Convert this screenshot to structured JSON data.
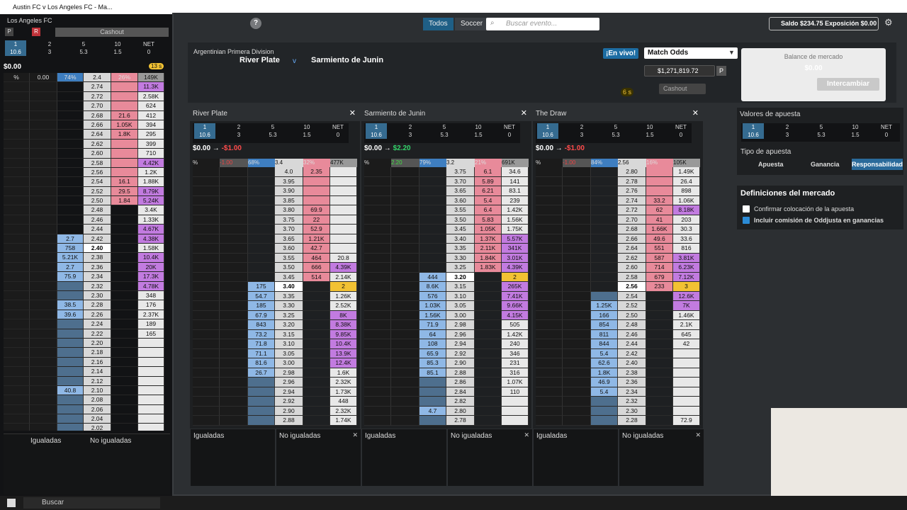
{
  "window": {
    "left_title": "Austin FC v Los Angeles FC - Ma..."
  },
  "topbar": {
    "help": "?",
    "tabs": [
      "Todos",
      "Soccer"
    ],
    "search_placeholder": "Buscar evento...",
    "saldo": "Saldo $234.75",
    "exposicion": "Exposición $0.00"
  },
  "event": {
    "league": "Argentinian Primera Division",
    "home": "River Plate",
    "vs": "v",
    "away": "Sarmiento de Junin",
    "live": "¡En vivo!",
    "market": "Match Odds",
    "matched": "$1,271,819.72",
    "timer": "6 s",
    "cashout": "Cashout",
    "p": "P",
    "q": "?"
  },
  "balance": {
    "label": "Balance de mercado",
    "value": "$0.00",
    "swap": "Intercambiar"
  },
  "stakes": [
    {
      "top": "1",
      "bot": "10.6"
    },
    {
      "top": "2",
      "bot": "3"
    },
    {
      "top": "5",
      "bot": "5.3"
    },
    {
      "top": "10",
      "bot": "1.5"
    },
    {
      "top": "NET",
      "bot": "0"
    }
  ],
  "panels": [
    {
      "name": "River Plate",
      "pnl_a": "$0.00",
      "pnl_b": "-$1.00",
      "hdr": [
        "%",
        "-1.00",
        "68%",
        "3.4",
        "32%",
        "477K"
      ],
      "rows": [
        [
          "",
          "",
          "",
          "4.0",
          "2.35",
          ""
        ],
        [
          "",
          "",
          "",
          "3.95",
          "",
          ""
        ],
        [
          "",
          "",
          "",
          "3.90",
          "",
          ""
        ],
        [
          "",
          "",
          "",
          "3.85",
          "",
          ""
        ],
        [
          "",
          "",
          "",
          "3.80",
          "69.9",
          ""
        ],
        [
          "",
          "",
          "",
          "3.75",
          "22",
          ""
        ],
        [
          "",
          "",
          "",
          "3.70",
          "52.9",
          ""
        ],
        [
          "",
          "",
          "",
          "3.65",
          "1.21K",
          ""
        ],
        [
          "",
          "",
          "",
          "3.60",
          "42.7",
          ""
        ],
        [
          "",
          "",
          "",
          "3.55",
          "464",
          "20.8"
        ],
        [
          "",
          "",
          "",
          "3.50",
          "666",
          "4.39K"
        ],
        [
          "",
          "",
          "",
          "3.45",
          "514",
          "2.14K"
        ],
        [
          "",
          "",
          "175",
          "3.40",
          "",
          "2"
        ],
        [
          "",
          "",
          "54.7",
          "3.35",
          "",
          "1.26K"
        ],
        [
          "",
          "",
          "185",
          "3.30",
          "",
          "2.52K"
        ],
        [
          "",
          "",
          "67.9",
          "3.25",
          "",
          "8K"
        ],
        [
          "",
          "",
          "843",
          "3.20",
          "",
          "8.38K"
        ],
        [
          "",
          "",
          "73.2",
          "3.15",
          "",
          "9.85K"
        ],
        [
          "",
          "",
          "71.8",
          "3.10",
          "",
          "10.4K"
        ],
        [
          "",
          "",
          "71.1",
          "3.05",
          "",
          "13.9K"
        ],
        [
          "",
          "",
          "81.6",
          "3.00",
          "",
          "12.4K"
        ],
        [
          "",
          "",
          "26.7",
          "2.98",
          "",
          "1.6K"
        ],
        [
          "",
          "",
          "",
          "2.96",
          "",
          "2.32K"
        ],
        [
          "",
          "",
          "",
          "2.94",
          "",
          "1.73K"
        ],
        [
          "",
          "",
          "",
          "2.92",
          "",
          "448"
        ],
        [
          "",
          "",
          "",
          "2.90",
          "",
          "2.32K"
        ],
        [
          "",
          "",
          "",
          "2.88",
          "",
          "1.74K"
        ]
      ],
      "cur": 12
    },
    {
      "name": "Sarmiento de Junin",
      "pnl_a": "$0.00",
      "pnl_b": "$2.20",
      "hdr": [
        "%",
        "2.20",
        "79%",
        "3.2",
        "21%",
        "691K"
      ],
      "rows": [
        [
          "",
          "",
          "",
          "3.75",
          "6.1",
          "34.6"
        ],
        [
          "",
          "",
          "",
          "3.70",
          "5.89",
          "141"
        ],
        [
          "",
          "",
          "",
          "3.65",
          "6.21",
          "83.1"
        ],
        [
          "",
          "",
          "",
          "3.60",
          "5.4",
          "239"
        ],
        [
          "",
          "",
          "",
          "3.55",
          "6.4",
          "1.42K"
        ],
        [
          "",
          "",
          "",
          "3.50",
          "5.83",
          "1.56K"
        ],
        [
          "",
          "",
          "",
          "3.45",
          "1.05K",
          "1.75K"
        ],
        [
          "",
          "",
          "",
          "3.40",
          "1.37K",
          "5.57K"
        ],
        [
          "",
          "",
          "",
          "3.35",
          "2.11K",
          "341K"
        ],
        [
          "",
          "",
          "",
          "3.30",
          "1.84K",
          "3.01K"
        ],
        [
          "",
          "",
          "",
          "3.25",
          "1.83K",
          "4.39K"
        ],
        [
          "",
          "",
          "444",
          "3.20",
          "",
          "2"
        ],
        [
          "",
          "",
          "8.6K",
          "3.15",
          "",
          "265K"
        ],
        [
          "",
          "",
          "576",
          "3.10",
          "",
          "7.41K"
        ],
        [
          "",
          "",
          "1.03K",
          "3.05",
          "",
          "9.66K"
        ],
        [
          "",
          "",
          "1.56K",
          "3.00",
          "",
          "4.15K"
        ],
        [
          "",
          "",
          "71.9",
          "2.98",
          "",
          "505"
        ],
        [
          "",
          "",
          "64",
          "2.96",
          "",
          "1.42K"
        ],
        [
          "",
          "",
          "108",
          "2.94",
          "",
          "240"
        ],
        [
          "",
          "",
          "65.9",
          "2.92",
          "",
          "346"
        ],
        [
          "",
          "",
          "85.3",
          "2.90",
          "",
          "231"
        ],
        [
          "",
          "",
          "85.1",
          "2.88",
          "",
          "316"
        ],
        [
          "",
          "",
          "",
          "2.86",
          "",
          "1.07K"
        ],
        [
          "",
          "",
          "",
          "2.84",
          "",
          "110"
        ],
        [
          "",
          "",
          "",
          "2.82",
          "",
          ""
        ],
        [
          "",
          "",
          "4.7",
          "2.80",
          "",
          ""
        ],
        [
          "",
          "",
          "",
          "2.78",
          "",
          ""
        ]
      ],
      "cur": 11
    },
    {
      "name": "The Draw",
      "pnl_a": "$0.00",
      "pnl_b": "-$1.00",
      "hdr": [
        "%",
        "-1.00",
        "84%",
        "2.56",
        "16%",
        "105K"
      ],
      "rows": [
        [
          "",
          "",
          "",
          "2.80",
          "",
          "1.49K"
        ],
        [
          "",
          "",
          "",
          "2.78",
          "",
          "26.4"
        ],
        [
          "",
          "",
          "",
          "2.76",
          "",
          "898"
        ],
        [
          "",
          "",
          "",
          "2.74",
          "33.2",
          "1.06K"
        ],
        [
          "",
          "",
          "",
          "2.72",
          "62",
          "8.18K"
        ],
        [
          "",
          "",
          "",
          "2.70",
          "41",
          "203"
        ],
        [
          "",
          "",
          "",
          "2.68",
          "1.66K",
          "30.3"
        ],
        [
          "",
          "",
          "",
          "2.66",
          "49.6",
          "33.6"
        ],
        [
          "",
          "",
          "",
          "2.64",
          "551",
          "816"
        ],
        [
          "",
          "",
          "",
          "2.62",
          "587",
          "3.81K"
        ],
        [
          "",
          "",
          "",
          "2.60",
          "714",
          "6.23K"
        ],
        [
          "",
          "",
          "",
          "2.58",
          "679",
          "7.12K"
        ],
        [
          "",
          "",
          "",
          "2.56",
          "233",
          "3"
        ],
        [
          "",
          "",
          "",
          "2.54",
          "",
          "12.6K"
        ],
        [
          "",
          "",
          "1.25K",
          "2.52",
          "",
          "7K"
        ],
        [
          "",
          "",
          "166",
          "2.50",
          "",
          "1.46K"
        ],
        [
          "",
          "",
          "854",
          "2.48",
          "",
          "2.1K"
        ],
        [
          "",
          "",
          "811",
          "2.46",
          "",
          "645"
        ],
        [
          "",
          "",
          "844",
          "2.44",
          "",
          "42"
        ],
        [
          "",
          "",
          "5.4",
          "2.42",
          "",
          ""
        ],
        [
          "",
          "",
          "62.6",
          "2.40",
          "",
          ""
        ],
        [
          "",
          "",
          "1.8K",
          "2.38",
          "",
          ""
        ],
        [
          "",
          "",
          "46.9",
          "2.36",
          "",
          ""
        ],
        [
          "",
          "",
          "5.4",
          "2.34",
          "",
          ""
        ],
        [
          "",
          "",
          "",
          "2.32",
          "",
          ""
        ],
        [
          "",
          "",
          "",
          "2.30",
          "",
          ""
        ],
        [
          "",
          "",
          "",
          "2.28",
          "",
          "72.9"
        ]
      ],
      "cur": 12
    }
  ],
  "bets": {
    "matched": "Igualadas",
    "unmatched": "No igualadas"
  },
  "valores": {
    "title": "Valores de apuesta",
    "tipo": "Tipo de apuesta",
    "types": [
      "Apuesta",
      "Ganancia",
      "Responsabilidad"
    ]
  },
  "defs": {
    "title": "Definiciones del mercado",
    "opt1": "Confirmar colocación de la apuesta",
    "opt2": "Incluir comisión de Oddjusta en ganancias"
  },
  "left": {
    "team": "Los Angeles FC",
    "cashout": "Cashout",
    "p": "P",
    "r": "R",
    "pnl": "$0.00",
    "timer": "13 s",
    "hdr": [
      "%",
      "0.00",
      "74%",
      "2.4",
      "26%",
      "149K"
    ],
    "rows": [
      [
        "",
        "",
        "",
        "2.74",
        "",
        "11.3K"
      ],
      [
        "",
        "",
        "",
        "2.72",
        "",
        "2.58K"
      ],
      [
        "",
        "",
        "",
        "2.70",
        "",
        "624"
      ],
      [
        "",
        "",
        "",
        "2.68",
        "21.6",
        "412"
      ],
      [
        "",
        "",
        "",
        "2.66",
        "1.05K",
        "394"
      ],
      [
        "",
        "",
        "",
        "2.64",
        "1.8K",
        "295"
      ],
      [
        "",
        "",
        "",
        "2.62",
        "",
        "399"
      ],
      [
        "",
        "",
        "",
        "2.60",
        "",
        "710"
      ],
      [
        "",
        "",
        "",
        "2.58",
        "",
        "4.42K"
      ],
      [
        "",
        "",
        "",
        "2.56",
        "",
        "1.2K"
      ],
      [
        "",
        "",
        "",
        "2.54",
        "16.1",
        "1.88K"
      ],
      [
        "",
        "",
        "",
        "2.52",
        "29.5",
        "8.79K"
      ],
      [
        "",
        "",
        "",
        "2.50",
        "1.84",
        "5.24K"
      ],
      [
        "",
        "",
        "",
        "2.48",
        "",
        "3.4K"
      ],
      [
        "",
        "",
        "",
        "2.46",
        "",
        "1.33K"
      ],
      [
        "",
        "",
        "",
        "2.44",
        "",
        "4.67K"
      ],
      [
        "",
        "",
        "2.7",
        "2.42",
        "",
        "4.38K"
      ],
      [
        "",
        "",
        "758",
        "2.40",
        "",
        "1.58K"
      ],
      [
        "",
        "",
        "5.21K",
        "2.38",
        "",
        "10.4K"
      ],
      [
        "",
        "",
        "2.7",
        "2.36",
        "",
        "20K"
      ],
      [
        "",
        "",
        "75.9",
        "2.34",
        "",
        "17.3K"
      ],
      [
        "",
        "",
        "",
        "2.32",
        "",
        "4.78K"
      ],
      [
        "",
        "",
        "",
        "2.30",
        "",
        "348"
      ],
      [
        "",
        "",
        "38.5",
        "2.28",
        "",
        "176"
      ],
      [
        "",
        "",
        "39.6",
        "2.26",
        "",
        "2.37K"
      ],
      [
        "",
        "",
        "",
        "2.24",
        "",
        "189"
      ],
      [
        "",
        "",
        "",
        "2.22",
        "",
        "165"
      ],
      [
        "",
        "",
        "",
        "2.20",
        "",
        ""
      ],
      [
        "",
        "",
        "",
        "2.18",
        "",
        ""
      ],
      [
        "",
        "",
        "",
        "2.16",
        "",
        ""
      ],
      [
        "",
        "",
        "",
        "2.14",
        "",
        ""
      ],
      [
        "",
        "",
        "",
        "2.12",
        "",
        ""
      ],
      [
        "",
        "",
        "40.8",
        "2.10",
        "",
        ""
      ],
      [
        "",
        "",
        "",
        "2.08",
        "",
        ""
      ],
      [
        "",
        "",
        "",
        "2.06",
        "",
        ""
      ],
      [
        "",
        "",
        "",
        "2.04",
        "",
        ""
      ],
      [
        "",
        "",
        "",
        "2.02",
        "",
        ""
      ]
    ],
    "cur": 17
  },
  "taskbar": {
    "search": "Buscar"
  }
}
